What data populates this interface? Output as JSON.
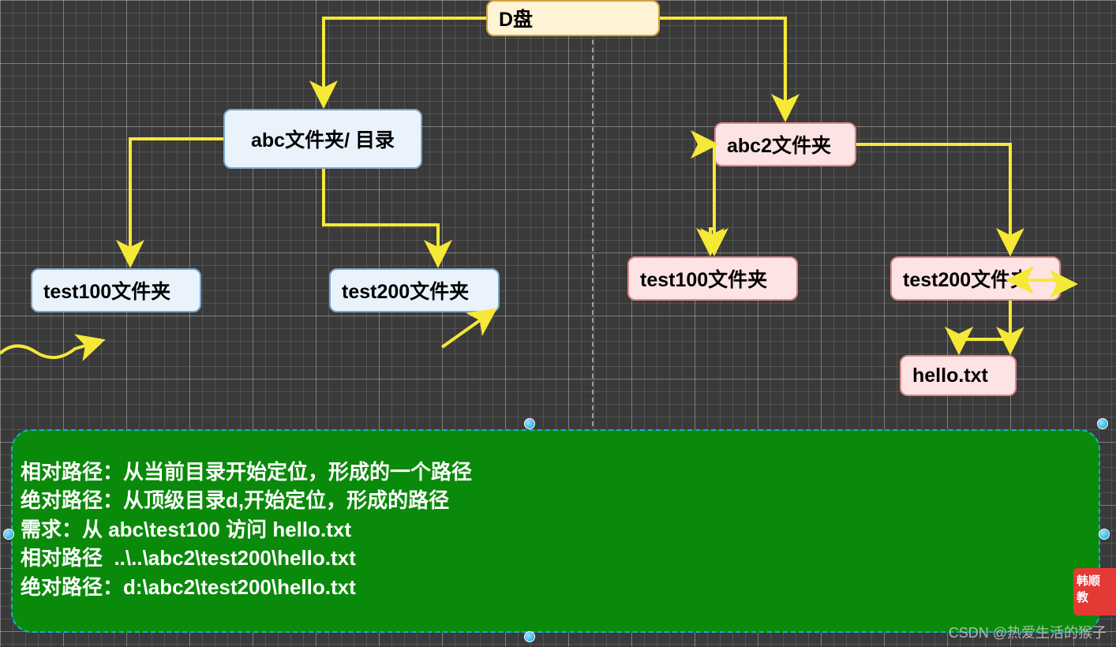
{
  "nodes": {
    "root": {
      "label": "D盘"
    },
    "abc": {
      "label": "abc文件夹/ 目录"
    },
    "t100l": {
      "label": "test100文件夹"
    },
    "t200l": {
      "label": "test200文件夹"
    },
    "abc2": {
      "label": "abc2文件夹"
    },
    "t100r": {
      "label": "test100文件夹"
    },
    "t200r": {
      "label": "test200文件夹"
    },
    "hello": {
      "label": "hello.txt"
    }
  },
  "panel": {
    "line1": "相对路径：从当前目录开始定位，形成的一个路径",
    "line2": "绝对路径：从顶级目录d,开始定位，形成的路径",
    "line3": "需求：从 abc\\test100 访问 hello.txt",
    "line4": "相对路径  ..\\..\\abc2\\test200\\hello.txt",
    "line5": "绝对路径：d:\\abc2\\test200\\hello.txt"
  },
  "badge": {
    "line1": "韩顺",
    "line2": "教  "
  },
  "watermark": "CSDN @热爱生活的猴子",
  "colors": {
    "arrow": "#f5e837",
    "blueDash": "#1aa9e0"
  }
}
